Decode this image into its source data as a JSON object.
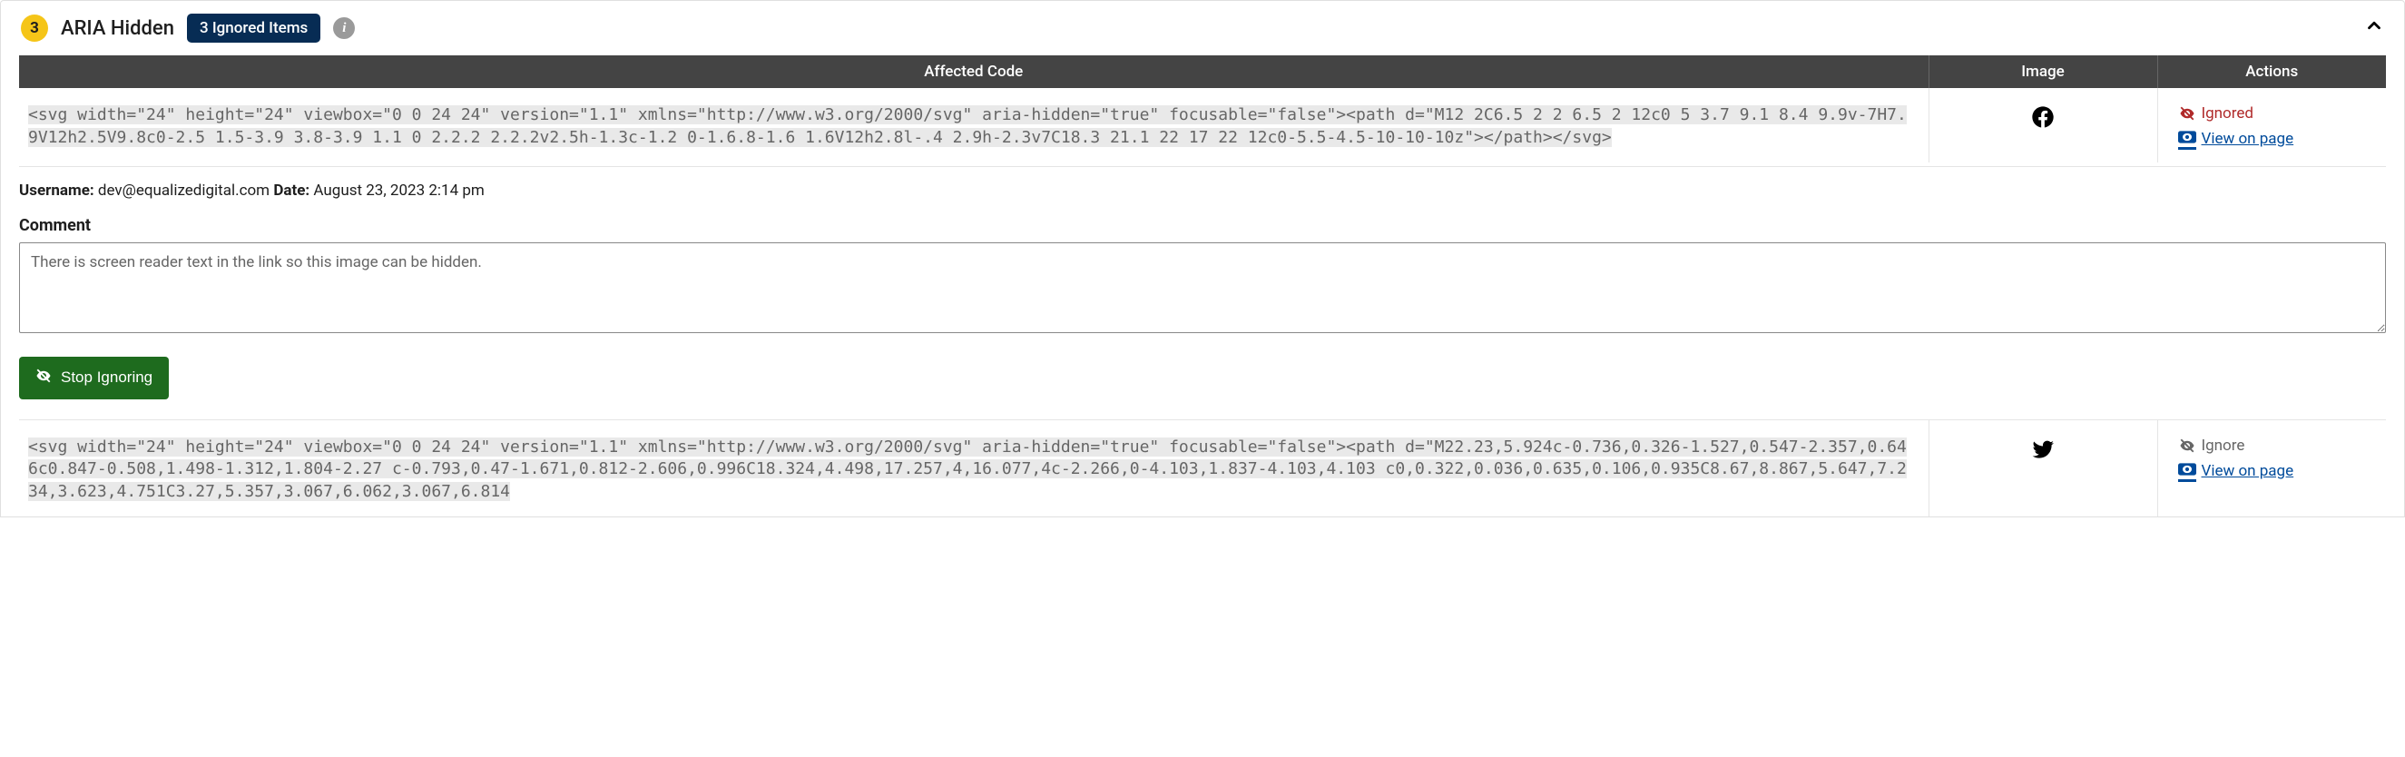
{
  "header": {
    "count": "3",
    "title": "ARIA Hidden",
    "ignored_pill": "3 Ignored Items"
  },
  "columns": {
    "code": "Affected Code",
    "image": "Image",
    "actions": "Actions"
  },
  "rows": [
    {
      "code": "<svg width=\"24\" height=\"24\" viewbox=\"0 0 24 24\" version=\"1.1\" xmlns=\"http://www.w3.org/2000/svg\" aria-hidden=\"true\" focusable=\"false\"><path d=\"M12 2C6.5 2 2 6.5 2 12c0 5 3.7 9.1 8.4 9.9v-7H7.9V12h2.5V9.8c0-2.5 1.5-3.9 3.8-3.9 1.1 0 2.2.2 2.2.2v2.5h-1.3c-1.2 0-1.6.8-1.6 1.6V12h2.8l-.4 2.9h-2.3v7C18.3 21.1 22 17 22 12c0-5.5-4.5-10-10-10z\"></path></svg>",
      "ignored_label": "Ignored",
      "view_label": "View on page"
    },
    {
      "code": "<svg width=\"24\" height=\"24\" viewbox=\"0 0 24 24\" version=\"1.1\" xmlns=\"http://www.w3.org/2000/svg\" aria-hidden=\"true\" focusable=\"false\"><path d=\"M22.23,5.924c-0.736,0.326-1.527,0.547-2.357,0.646c0.847-0.508,1.498-1.312,1.804-2.27 c-0.793,0.47-1.671,0.812-2.606,0.996C18.324,4.498,17.257,4,16.077,4c-2.266,0-4.103,1.837-4.103,4.103 c0,0.322,0.036,0.635,0.106,0.935C8.67,8.867,5.647,7.234,3.623,4.751C3.27,5.357,3.067,6.062,3.067,6.814",
      "ignore_label": "Ignore",
      "view_label": "View on page"
    }
  ],
  "expanded": {
    "username_label": "Username:",
    "username_value": "dev@equalizedigital.com",
    "date_label": "Date:",
    "date_value": "August 23, 2023 2:14 pm",
    "comment_label": "Comment",
    "comment_value": "There is screen reader text in the link so this image can be hidden.",
    "stop_button": "Stop Ignoring"
  }
}
